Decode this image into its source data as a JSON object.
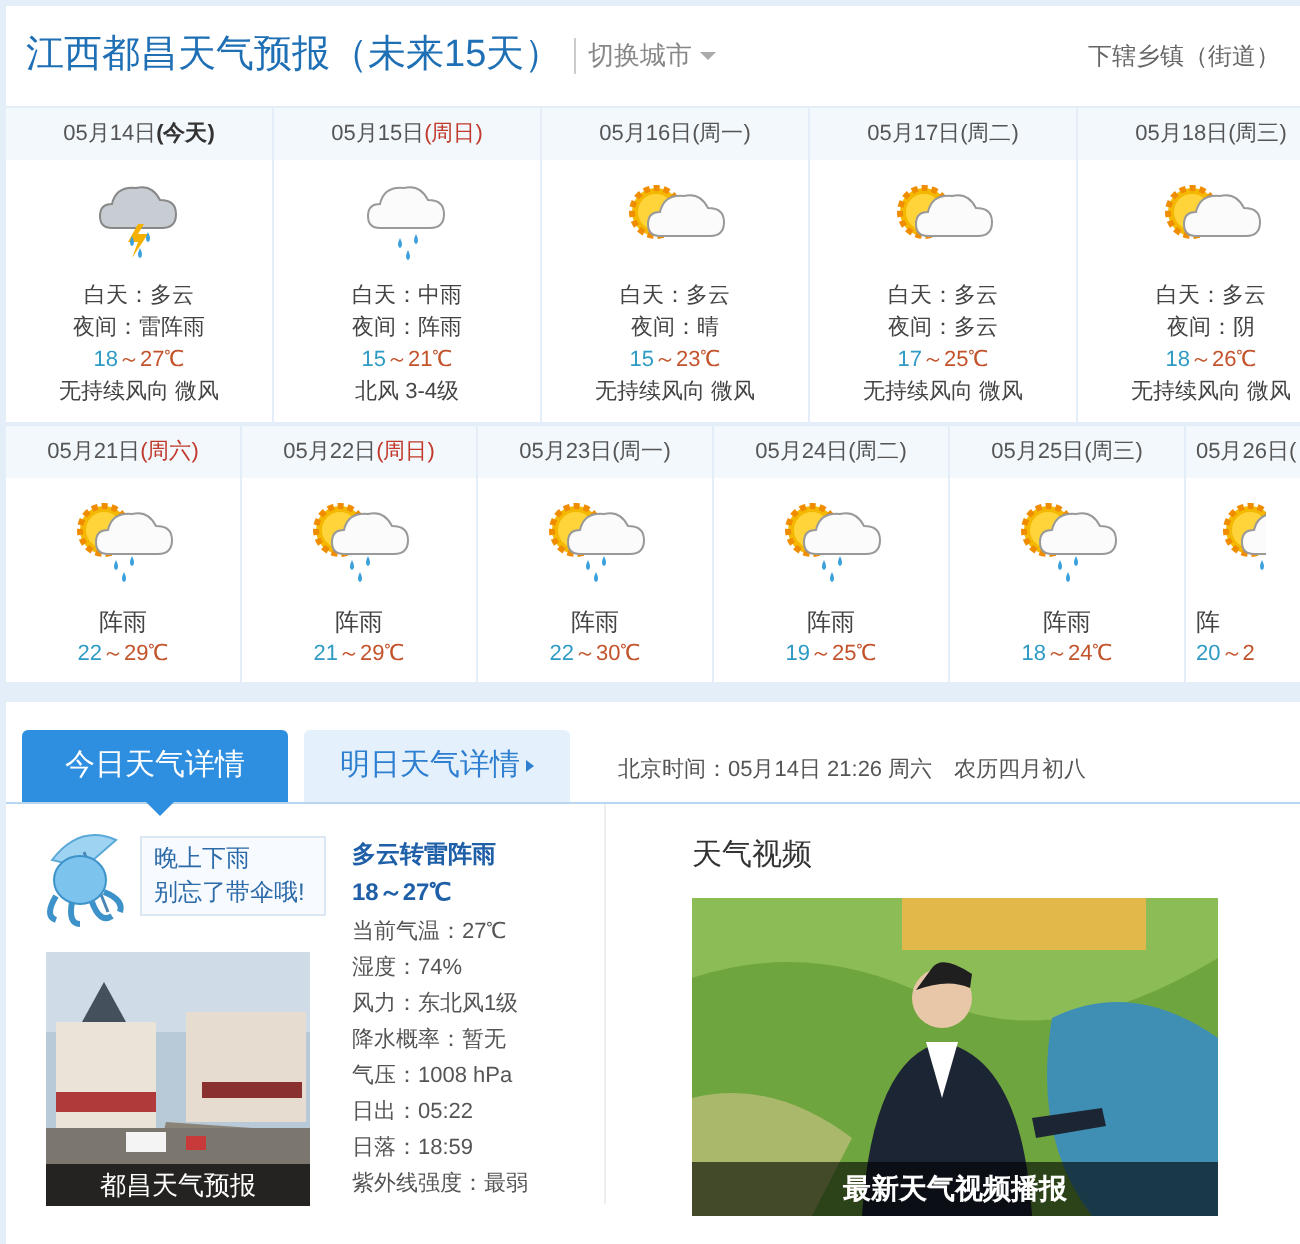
{
  "header": {
    "title": "江西都昌天气预报（未来15天）",
    "switch_city": "切换城市",
    "towns_link": "下辖乡镇（街道）"
  },
  "week1": [
    {
      "date": "05月14日",
      "weekday": "(今天)",
      "today": true,
      "color": "#333333",
      "kind": "thunder_rain",
      "day": "白天：多云",
      "night": "夜间：雷阵雨",
      "low": "18",
      "high": "～27℃",
      "wind": "无持续风向 微风"
    },
    {
      "date": "05月15日",
      "weekday": "(周日)",
      "today": false,
      "color": "#c0392b",
      "kind": "rain",
      "day": "白天：中雨",
      "night": "夜间：阵雨",
      "low": "15",
      "high": "～21℃",
      "wind": "北风 3-4级"
    },
    {
      "date": "05月16日",
      "weekday": "(周一)",
      "today": false,
      "color": "#555555",
      "kind": "partly_cloudy",
      "day": "白天：多云",
      "night": "夜间：晴",
      "low": "15",
      "high": "～23℃",
      "wind": "无持续风向 微风"
    },
    {
      "date": "05月17日",
      "weekday": "(周二)",
      "today": false,
      "color": "#555555",
      "kind": "partly_cloudy",
      "day": "白天：多云",
      "night": "夜间：多云",
      "low": "17",
      "high": "～25℃",
      "wind": "无持续风向 微风"
    },
    {
      "date": "05月18日",
      "weekday": "(周三)",
      "today": false,
      "color": "#555555",
      "kind": "partly_cloudy",
      "day": "白天：多云",
      "night": "夜间：阴",
      "low": "18",
      "high": "～26℃",
      "wind": "无持续风向 微风"
    }
  ],
  "week2": [
    {
      "date": "05月21日",
      "weekday": "(周六)",
      "color": "#c0392b",
      "kind": "sun_shower",
      "condition": "阵雨",
      "low": "22",
      "high": "～29℃"
    },
    {
      "date": "05月22日",
      "weekday": "(周日)",
      "color": "#c0392b",
      "kind": "sun_shower",
      "condition": "阵雨",
      "low": "21",
      "high": "～29℃"
    },
    {
      "date": "05月23日",
      "weekday": "(周一)",
      "color": "#555555",
      "kind": "sun_shower",
      "condition": "阵雨",
      "low": "22",
      "high": "～30℃"
    },
    {
      "date": "05月24日",
      "weekday": "(周二)",
      "color": "#555555",
      "kind": "sun_shower",
      "condition": "阵雨",
      "low": "19",
      "high": "～25℃"
    },
    {
      "date": "05月25日",
      "weekday": "(周三)",
      "color": "#555555",
      "kind": "sun_shower",
      "condition": "阵雨",
      "low": "18",
      "high": "～24℃"
    },
    {
      "date": "05月26日(",
      "kind": "sun_shower",
      "condition": "阵",
      "low": "20",
      "high": "～2"
    }
  ],
  "tabs": [
    {
      "label": "今日天气详情",
      "selected": true
    },
    {
      "label": "明日天气详情",
      "selected": false
    }
  ],
  "time_info": "北京时间：05月14日 21:26 周六　农历四月初八",
  "tip": {
    "lines": [
      "晚上下雨",
      "别忘了带伞哦!"
    ]
  },
  "photo": {
    "caption": "都昌天气预报"
  },
  "today": {
    "summary": "多云转雷阵雨",
    "temp": "18～27℃",
    "details": [
      "当前气温：27℃",
      "湿度：74%",
      "风力：东北风1级",
      "降水概率：暂无",
      "气压：1008 hPa",
      "日出：05:22",
      "日落：18:59",
      "紫外线强度：最弱"
    ]
  },
  "video": {
    "title": "天气视频",
    "caption": "最新天气视频播报"
  }
}
